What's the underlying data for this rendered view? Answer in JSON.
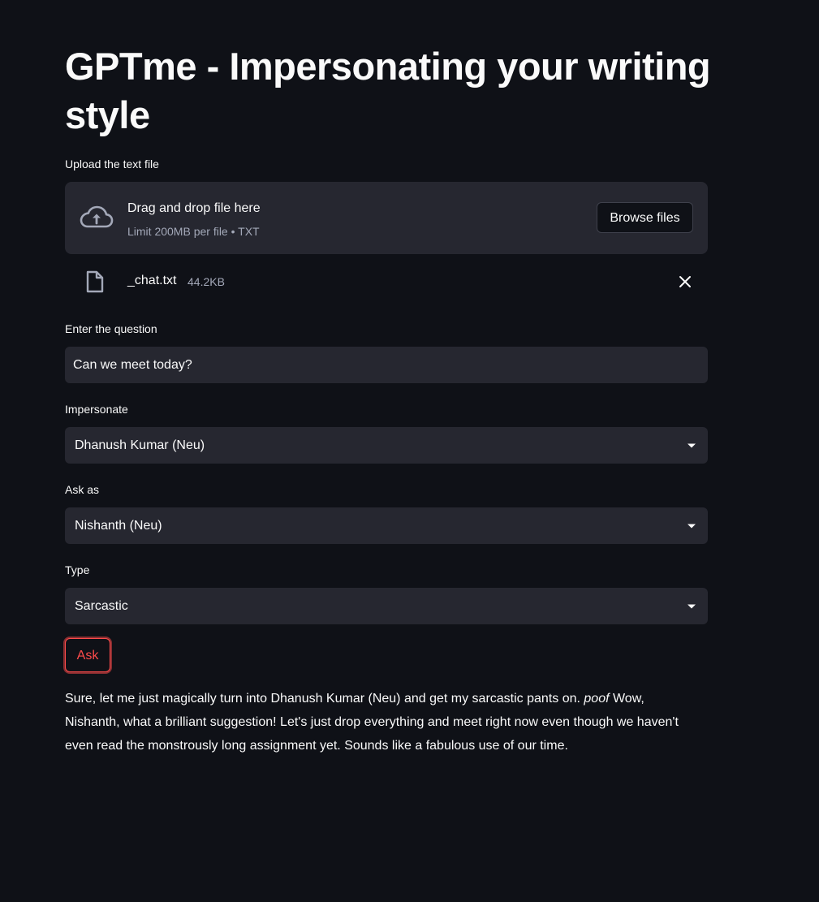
{
  "page": {
    "title": "GPTme - Impersonating your writing style"
  },
  "uploader": {
    "label": "Upload the text file",
    "drop_title": "Drag and drop file here",
    "limit_text": "Limit 200MB per file • TXT",
    "browse_label": "Browse files",
    "file": {
      "name": "_chat.txt",
      "size": "44.2KB"
    }
  },
  "question": {
    "label": "Enter the question",
    "value": "Can we meet today?"
  },
  "impersonate": {
    "label": "Impersonate",
    "selected": "Dhanush Kumar (Neu)"
  },
  "ask_as": {
    "label": "Ask as",
    "selected": "Nishanth (Neu)"
  },
  "type": {
    "label": "Type",
    "selected": "Sarcastic"
  },
  "ask_button": {
    "label": "Ask"
  },
  "answer": {
    "before": "Sure, let me just magically turn into Dhanush Kumar (Neu) and get my sarcastic pants on. ",
    "emphasis": "poof",
    "after": " Wow, Nishanth, what a brilliant suggestion! Let's just drop everything and meet right now even though we haven't even read the monstrously long assignment yet. Sounds like a fabulous use of our time."
  },
  "colors": {
    "background": "#0f1117",
    "surface": "#262730",
    "text": "#fafafa",
    "muted_text": "#a3a8b8",
    "accent": "#ff4b4b"
  },
  "icons": {
    "upload": "cloud-upload-icon",
    "file": "file-icon",
    "remove": "close-icon",
    "dropdown": "chevron-down-icon"
  }
}
